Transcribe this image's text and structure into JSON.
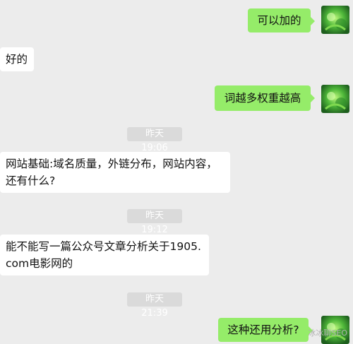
{
  "conversation": {
    "messages": [
      {
        "side": "out",
        "text": "可以加的"
      },
      {
        "side": "in",
        "text": "好的"
      },
      {
        "side": "out",
        "text": "词越多权重越高"
      },
      {
        "side": "in",
        "lines": [
          "网站基础:域名质量，外链分布，网站内容，",
          "还有什么?"
        ]
      },
      {
        "side": "in",
        "lines": [
          "能不能写一篇公众号文章分析关于1905.",
          "com电影网的"
        ]
      },
      {
        "side": "out",
        "text": "这种还用分析?"
      }
    ],
    "timestamps": [
      "昨天 19:06",
      "昨天 19:12",
      "昨天 21:39"
    ]
  },
  "watermark": "冰冰聊SEO",
  "colors": {
    "background": "#ececec",
    "outgoing_bubble": "#95ec69",
    "incoming_bubble": "#ffffff",
    "timestamp_badge": "#dadada"
  },
  "icons": {
    "avatar": "green-nature-avatar-icon"
  }
}
